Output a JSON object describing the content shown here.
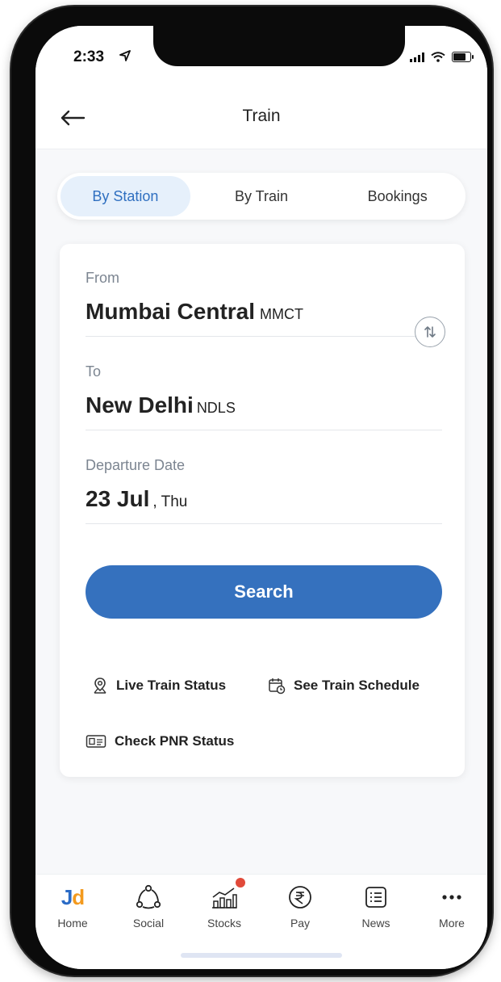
{
  "status_bar": {
    "time": "2:33"
  },
  "header": {
    "title": "Train"
  },
  "tabs": [
    {
      "label": "By Station",
      "active": true
    },
    {
      "label": "By Train",
      "active": false
    },
    {
      "label": "Bookings",
      "active": false
    }
  ],
  "form": {
    "from": {
      "label": "From",
      "station": "Mumbai Central",
      "code": "MMCT"
    },
    "to": {
      "label": "To",
      "station": "New Delhi",
      "code": "NDLS"
    },
    "departure": {
      "label": "Departure Date",
      "date": "23 Jul",
      "day": ", Thu"
    },
    "search_label": "Search"
  },
  "links": {
    "live_status": "Live Train Status",
    "schedule": "See Train Schedule",
    "pnr": "Check PNR Status"
  },
  "bottom_nav": [
    {
      "label": "Home",
      "icon": "jd-logo-icon"
    },
    {
      "label": "Social",
      "icon": "social-icon"
    },
    {
      "label": "Stocks",
      "icon": "stocks-icon"
    },
    {
      "label": "Pay",
      "icon": "rupee-icon"
    },
    {
      "label": "News",
      "icon": "news-icon"
    },
    {
      "label": "More",
      "icon": "more-icon"
    }
  ],
  "logo": {
    "j": "J",
    "d": "d"
  },
  "colors": {
    "accent": "#3571be",
    "active_tab_bg": "#e6f0fb",
    "active_tab_text": "#2f6fc0",
    "logo_blue": "#2a6bc6",
    "logo_orange": "#f39a1e",
    "notification_dot": "#e14a3a"
  }
}
